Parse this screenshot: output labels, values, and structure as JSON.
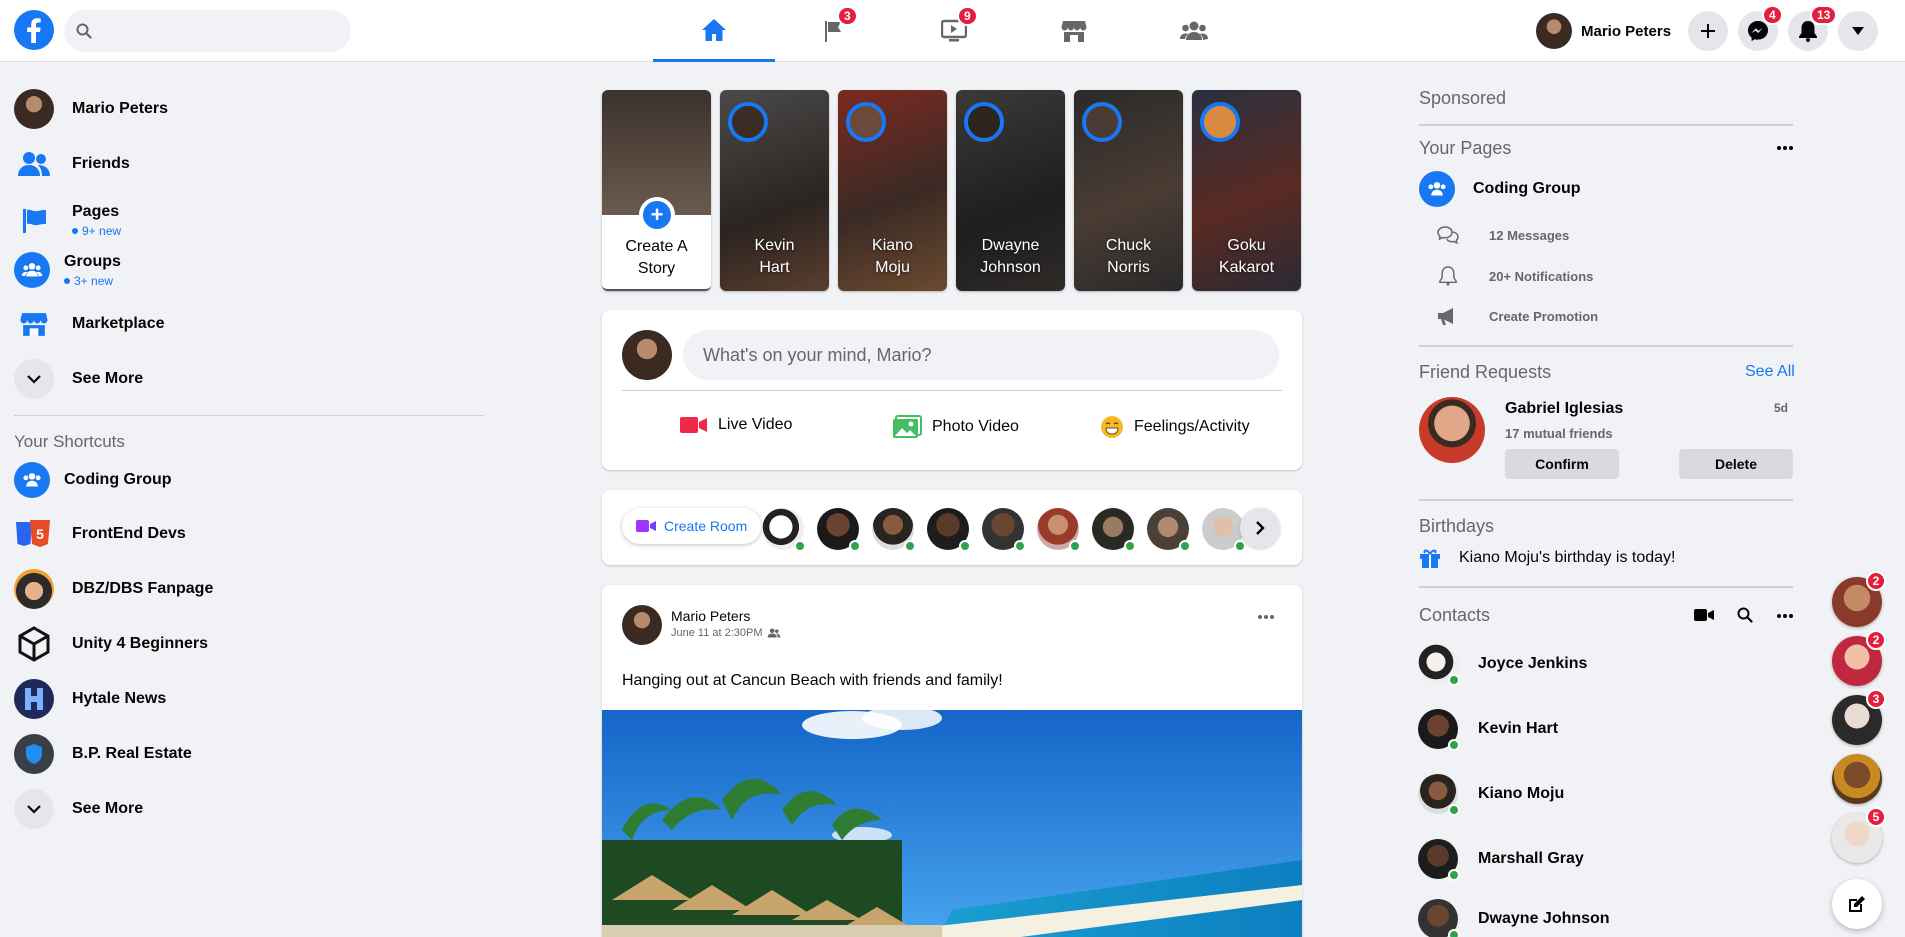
{
  "header": {
    "search_placeholder": "",
    "profile_name": "Mario Peters",
    "badges": {
      "pages": "3",
      "watch": "9",
      "messenger": "4",
      "notifications": "13"
    }
  },
  "left": {
    "items": [
      {
        "label": "Mario Peters"
      },
      {
        "label": "Friends"
      },
      {
        "label": "Pages",
        "sub": "9+ new"
      },
      {
        "label": "Groups",
        "sub": "3+ new"
      },
      {
        "label": "Marketplace"
      },
      {
        "label": "See More"
      }
    ],
    "shortcuts_title": "Your Shortcuts",
    "shortcuts": [
      {
        "label": "Coding Group"
      },
      {
        "label": "FrontEnd Devs"
      },
      {
        "label": "DBZ/DBS Fanpage"
      },
      {
        "label": "Unity 4 Beginners"
      },
      {
        "label": "Hytale News"
      },
      {
        "label": "B.P. Real Estate"
      },
      {
        "label": "See More"
      }
    ]
  },
  "stories": {
    "create_label": "Create A Story",
    "items": [
      {
        "name": "Kevin Hart"
      },
      {
        "name": "Kiano Moju"
      },
      {
        "name": "Dwayne Johnson"
      },
      {
        "name": "Chuck Norris"
      },
      {
        "name": "Goku Kakarot"
      }
    ]
  },
  "composer": {
    "placeholder": "What's on your mind, Mario?",
    "actions": [
      "Live Video",
      "Photo Video",
      "Feelings/Activity"
    ]
  },
  "rooms": {
    "create_label": "Create Room"
  },
  "post": {
    "author": "Mario Peters",
    "time": "June 11 at 2:30PM",
    "text": "Hanging out at Cancun Beach with friends and family!"
  },
  "right": {
    "sponsored": "Sponsored",
    "your_pages": "Your Pages",
    "page_name": "Coding Group",
    "page_rows": [
      "12 Messages",
      "20+ Notifications",
      "Create Promotion"
    ],
    "friend_requests": "Friend Requests",
    "see_all": "See All",
    "request": {
      "name": "Gabriel Iglesias",
      "mutual": "17 mutual friends",
      "age": "5d",
      "confirm": "Confirm",
      "delete": "Delete"
    },
    "birthdays": "Birthdays",
    "birthday_text": "Kiano Moju's birthday is today!",
    "contacts_title": "Contacts",
    "contacts": [
      "Joyce Jenkins",
      "Kevin Hart",
      "Kiano Moju",
      "Marshall Gray",
      "Dwayne Johnson"
    ]
  },
  "chat_heads": [
    {
      "badge": "2"
    },
    {
      "badge": "2"
    },
    {
      "badge": "3"
    },
    {
      "badge": ""
    },
    {
      "badge": "5"
    }
  ],
  "colors": {
    "accent": "#1877f2",
    "badge": "#e41e3f",
    "online": "#31a24c"
  }
}
